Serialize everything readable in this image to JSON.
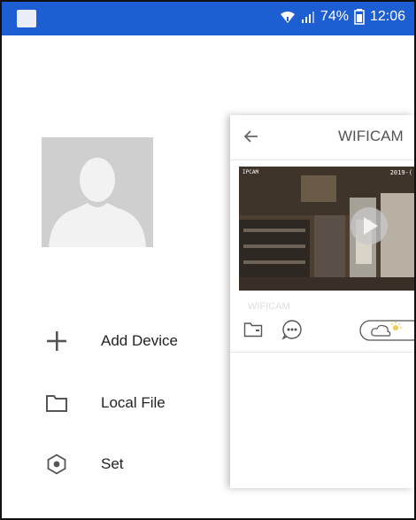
{
  "status_bar": {
    "battery_percent": "74%",
    "time": "12:06",
    "icons": [
      "notification-square-icon",
      "wifi-icon",
      "signal-icon",
      "battery-icon"
    ]
  },
  "drawer": {
    "avatar": "default-user-avatar",
    "menu": [
      {
        "label": "Add Device",
        "icon": "plus-icon"
      },
      {
        "label": "Local File",
        "icon": "folder-icon"
      },
      {
        "label": "Set",
        "icon": "settings-icon"
      }
    ]
  },
  "main_card": {
    "title": "WIFICAM",
    "device": {
      "name": "WIFICAM",
      "timestamp_left": "IPCAM",
      "timestamp_right": "2019-(",
      "actions": [
        "folder-icon",
        "more-bubble-icon",
        "weather-cloud-icon"
      ]
    }
  },
  "colors": {
    "status_bar": "#1d5ed2",
    "menu_icon": "#555555",
    "avatar_bg": "#cfcfcf"
  }
}
